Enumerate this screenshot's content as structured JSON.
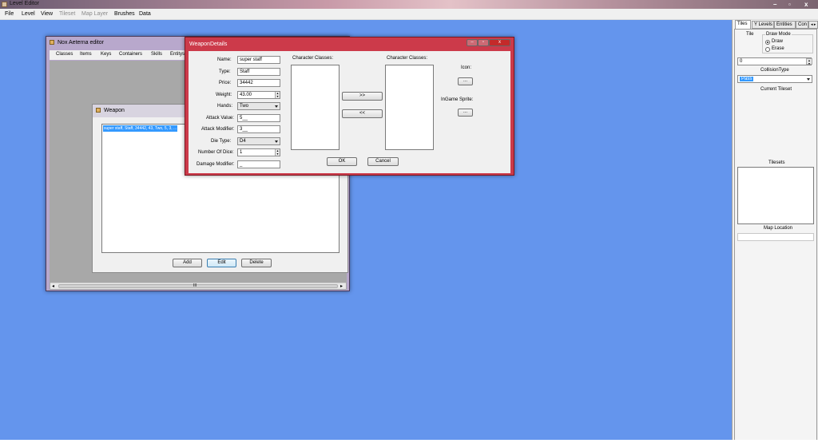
{
  "app": {
    "title": "Level Editor"
  },
  "menu": {
    "file": "File",
    "level": "Level",
    "view": "View",
    "tileset": "Tileset",
    "map_layer": "Map Layer",
    "brushes": "Brushes",
    "data": "Data"
  },
  "window_controls": {
    "minimize": "–",
    "maximize": "▫",
    "close": "x"
  },
  "right_panel": {
    "tabs": [
      "Tiles",
      "Y Levels",
      "Entities",
      "Con"
    ],
    "tab_arrows": "◂ ▸",
    "tile_label": "Tile",
    "draw_mode_label": "Draw Mode",
    "draw_option": "Draw",
    "erase_option": "Erase",
    "numeric_value": "0",
    "collision_type_label": "CollisionType",
    "collision_type_value": "Pass",
    "current_tileset_label": "Current Tileset",
    "tilesets_label": "Tilesets",
    "map_location_label": "Map Location"
  },
  "nox_window": {
    "title": "Nox Aeterna editor",
    "menu": [
      "Classes",
      "Items",
      "Keys",
      "Containers",
      "Skills",
      "Entitys"
    ],
    "scroll_grip": "III",
    "scroll_left": "◂",
    "scroll_right": "▸"
  },
  "weapon_window": {
    "title": "Weapon",
    "list_item": "super staff, Staff, 34442, 43, Two, 5, 3, ...",
    "add_button": "Add",
    "edit_button": "Edit",
    "delete_button": "Delete"
  },
  "weapon_details": {
    "title": "WeaponDetails",
    "labels": {
      "name": "Name:",
      "type": "Type:",
      "price": "Price:",
      "weight": "Weight:",
      "hands": "Hands:",
      "attack_value": "Attack Value:",
      "attack_modifier": "Attack Modifier:",
      "die_type": "Die Type:",
      "number_of_dice": "Number Of Dice:",
      "damage_modifier": "Damage Modifier:",
      "character_classes_left": "Character Classes:",
      "character_classes_right": "Character Classes:",
      "icon": "Icon:",
      "ingame_sprite": "InGame Sprite:"
    },
    "values": {
      "name": "super staff",
      "type": "Staff",
      "price": "34442",
      "weight": "43.00",
      "hands": "Two",
      "attack_value": "5__",
      "attack_modifier": "3__",
      "die_type": "D4",
      "number_of_dice": "1",
      "damage_modifier": "_"
    },
    "buttons": {
      "add": ">>",
      "remove": "<<",
      "icon_browse": "...",
      "sprite_browse": "...",
      "ok": "OK",
      "cancel": "Cancel"
    }
  },
  "colors": {
    "desktop": "#6495ed",
    "details_frame": "#cc3a4a",
    "nox_frame": "#b8a8cc"
  }
}
